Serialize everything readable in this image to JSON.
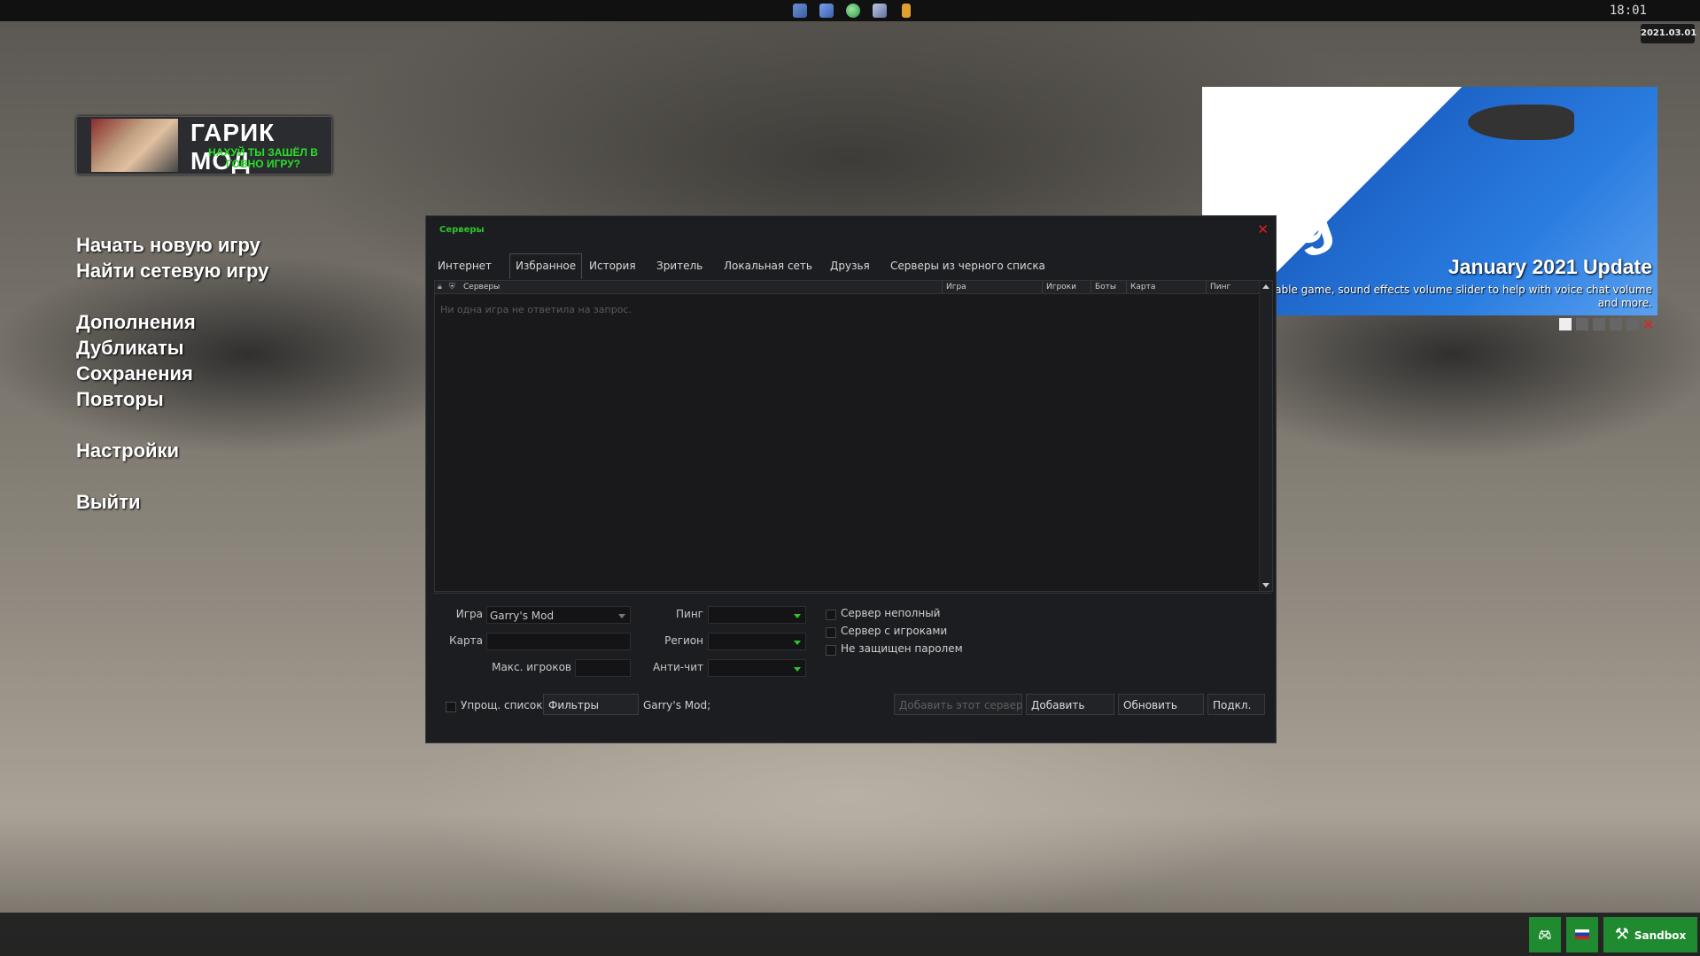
{
  "topbar": {
    "clock": "18:01",
    "date": "2021.03.01",
    "icons": [
      "pencil-icon",
      "brush-icon",
      "globe-icon",
      "wrench-icon",
      "page-icon"
    ]
  },
  "logo": {
    "title": "ГАРИК МОД",
    "subtitle": "НАХУЙ ТЫ ЗАШЁЛ В ГОВНО ИГРУ?"
  },
  "menu": {
    "new_game": "Начать новую игру",
    "find_game": "Найти сетевую игру",
    "addons": "Дополнения",
    "dupes": "Дубликаты",
    "saves": "Сохранения",
    "demos": "Повторы",
    "options": "Настройки",
    "quit": "Выйти"
  },
  "news": {
    "logo_text": "g",
    "title": "January 2021 Update",
    "desc": "able game, sound effects volume slider to help with voice chat volume and more."
  },
  "dialog": {
    "title": "Серверы",
    "tabs": [
      "Интернет",
      "Избранное",
      "История",
      "Зритель",
      "Локальная сеть",
      "Друзья",
      "Серверы из черного списка"
    ],
    "active_tab": "Избранное",
    "columns": {
      "servers": "Серверы",
      "game": "Игра",
      "players": "Игроки",
      "bots": "Боты",
      "map": "Карта",
      "ping": "Пинг"
    },
    "empty_message": "Ни одна игра не ответила на запрос.",
    "filters": {
      "game_label": "Игра",
      "game_value": "Garry's Mod",
      "map_label": "Карта",
      "map_value": "",
      "max_players_label": "Макс. игроков",
      "max_players_value": "",
      "ping_label": "Пинг",
      "ping_value": "",
      "region_label": "Регион",
      "region_value": "",
      "anticheat_label": "Анти-чит",
      "anticheat_value": "",
      "not_full": "Сервер неполный",
      "has_players": "Сервер с игроками",
      "no_password": "Не защищен паролем"
    },
    "bottom": {
      "simple_list": "Упрощ. список",
      "filters_button": "Фильтры",
      "filter_summary": "Garry's Mod;",
      "add_this_server": "Добавить этот сервер",
      "add": "Добавить",
      "refresh": "Обновить",
      "connect": "Подкл."
    }
  },
  "bottombar": {
    "gamemode": "Sandbox"
  },
  "colors": {
    "accent_green": "#2ec42e",
    "close_red": "#e02020",
    "gamemode_green": "#1f8a2f"
  }
}
